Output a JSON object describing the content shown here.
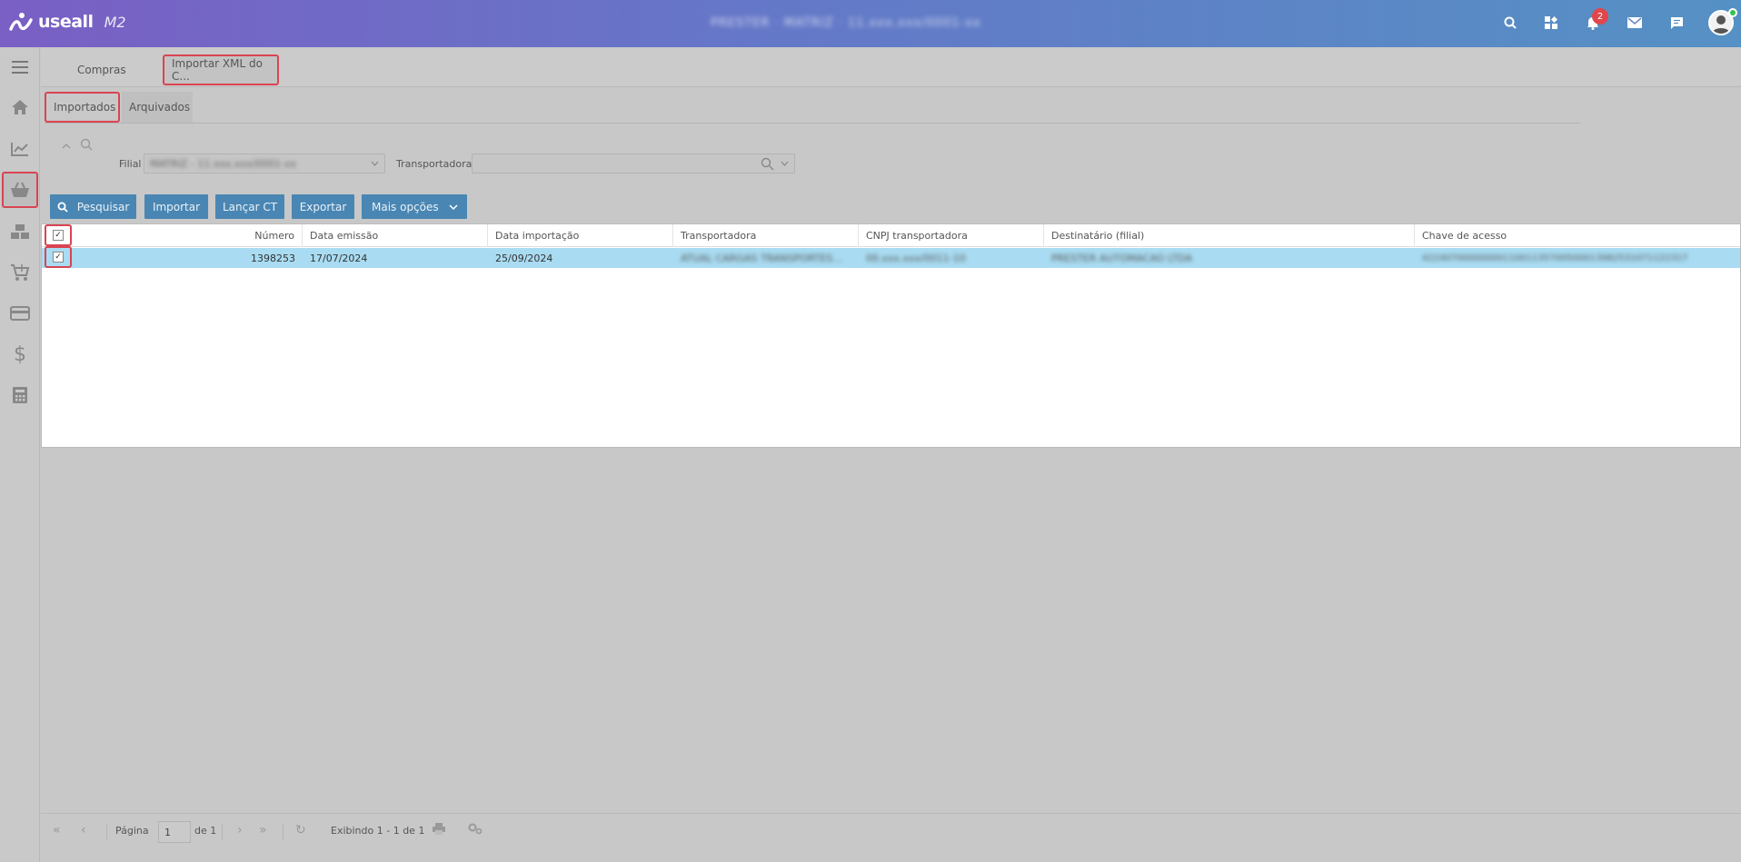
{
  "header": {
    "brand": "useall",
    "product": "M2",
    "center_text": "PRESTER · MATRIZ · 11.xxx.xxx/0001-xx",
    "notifications_count": "2",
    "icons": [
      "search-icon",
      "apps-icon",
      "bell-icon",
      "mail-icon",
      "chat-icon",
      "user-avatar"
    ]
  },
  "sidebar": {
    "items": [
      {
        "name": "menu",
        "icon": "hamburger-icon"
      },
      {
        "name": "home",
        "icon": "home-icon"
      },
      {
        "name": "dashboard",
        "icon": "chart-icon"
      },
      {
        "name": "compras",
        "icon": "basket-icon",
        "active": true
      },
      {
        "name": "estoque",
        "icon": "boxes-icon"
      },
      {
        "name": "vendas",
        "icon": "cart-icon"
      },
      {
        "name": "cartao",
        "icon": "card-icon"
      },
      {
        "name": "financeiro",
        "icon": "dollar-icon"
      },
      {
        "name": "calculadora",
        "icon": "calculator-icon"
      }
    ]
  },
  "tabs": [
    {
      "label": "Compras"
    },
    {
      "label": "Importar XML do C..."
    }
  ],
  "subtabs": [
    {
      "label": "Importados"
    },
    {
      "label": "Arquivados"
    }
  ],
  "filters": {
    "filial_label": "Filial",
    "filial_value": "MATRIZ - 11.xxx.xxx/0001-xx",
    "transportadora_label": "Transportadora",
    "transportadora_value": ""
  },
  "toolbar": {
    "pesquisar": "Pesquisar",
    "importar": "Importar",
    "lancar_ct": "Lançar CT",
    "exportar": "Exportar",
    "mais_opcoes": "Mais opções"
  },
  "grid": {
    "columns": [
      "Número",
      "Data emissão",
      "Data importação",
      "Transportadora",
      "CNPJ transportadora",
      "Destinatário (filial)",
      "Chave de acesso"
    ],
    "rows": [
      {
        "numero": "1398253",
        "data_emissao": "17/07/2024",
        "data_importacao": "25/09/2024",
        "transportadora": "ATUAL CARGAS TRANSPORTES...",
        "cnpj": "00.xxx.xxx/0011-10",
        "destinatario": "PRESTER AUTOMACAO LTDA",
        "chave": "4224070000000011001135700500013982531071122317"
      }
    ]
  },
  "pager": {
    "page_label": "Página",
    "page_value": "1",
    "of_label": "de 1",
    "display_text": "Exibindo 1 - 1 de 1"
  },
  "colors": {
    "header_start": "#7a5fc4",
    "header_end": "#5591c4",
    "button": "#4a86b3",
    "selected_row": "#a9dcf2",
    "highlight": "#d94452",
    "badge": "#e0474c"
  }
}
